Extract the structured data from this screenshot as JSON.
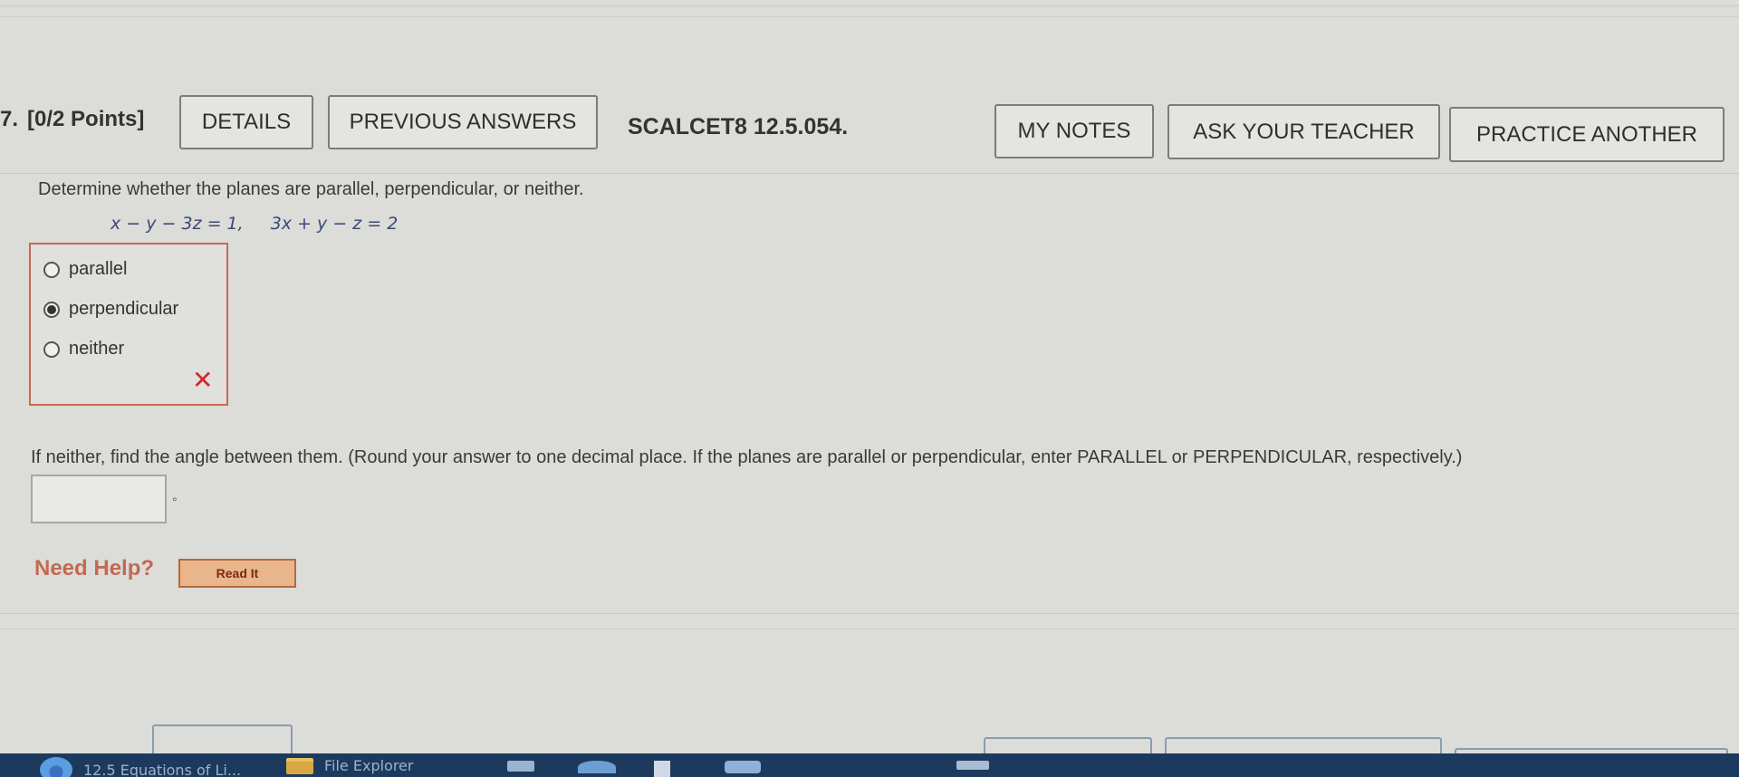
{
  "question": {
    "number": "7.",
    "points": "[0/2 Points]",
    "code": "SCALCET8 12.5.054.",
    "prompt": "Determine whether the planes are parallel, perpendicular, or neither.",
    "equation_1": "x − y − 3z = 1,",
    "equation_2": "3x + y − z = 2",
    "choices": [
      {
        "label": "parallel",
        "selected": false
      },
      {
        "label": "perpendicular",
        "selected": true
      },
      {
        "label": "neither",
        "selected": false
      }
    ],
    "followup": "If neither, find the angle between them. (Round your answer to one decimal place. If the planes are parallel or perpendicular, enter PARALLEL or PERPENDICULAR, respectively.)",
    "angle_value": "",
    "degree_symbol": "°",
    "wrong_mark": "✕"
  },
  "header_buttons": {
    "details": "DETAILS",
    "previous_answers": "PREVIOUS ANSWERS",
    "my_notes": "MY NOTES",
    "ask_teacher": "ASK YOUR TEACHER",
    "practice_another": "PRACTICE ANOTHER"
  },
  "help": {
    "need_help": "Need Help?",
    "read_it": "Read It"
  },
  "taskbar": {
    "browser_tab": "12.5 Equations of Li...",
    "file_explorer": "File Explorer"
  },
  "colors": {
    "incorrect_border": "#c86a52",
    "wrong_icon": "#cc2a2a",
    "need_help": "#c26a52",
    "read_it_bg": "#e9b58a",
    "taskbar": "#1c3a5e"
  },
  "icons": {
    "wrong": "x-mark-icon",
    "browser": "chrome-icon",
    "explorer": "folder-icon"
  }
}
